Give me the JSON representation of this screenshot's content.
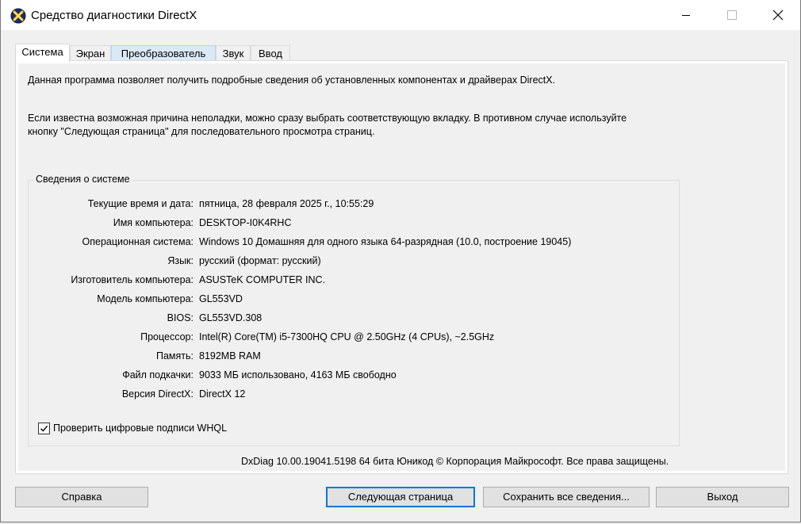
{
  "window": {
    "title": "Средство диагностики DirectX"
  },
  "tabs": [
    {
      "label": "Система",
      "active": true
    },
    {
      "label": "Экран",
      "active": false
    },
    {
      "label": "Преобразователь",
      "active": false
    },
    {
      "label": "Звук",
      "active": false
    },
    {
      "label": "Ввод",
      "active": false
    }
  ],
  "intro": {
    "line1": "Данная программа позволяет получить подробные сведения об установленных компонентах и драйверах DirectX.",
    "line2": "Если известна возможная причина неполадки, можно сразу выбрать соответствующую вкладку. В противном случае используйте",
    "line3": "кнопку \"Следующая страница\" для последовательного просмотра страниц."
  },
  "system_info": {
    "group_title": "Сведения о системе",
    "rows": [
      {
        "label": "Текущие время и дата:",
        "value": "пятница, 28 февраля 2025 г., 10:55:29"
      },
      {
        "label": "Имя компьютера:",
        "value": "DESKTOP-I0K4RHC"
      },
      {
        "label": "Операционная система:",
        "value": "Windows 10 Домашняя для одного языка 64-разрядная (10.0, построение 19045)"
      },
      {
        "label": "Язык:",
        "value": "русский (формат: русский)"
      },
      {
        "label": "Изготовитель компьютера:",
        "value": "ASUSTeK COMPUTER INC."
      },
      {
        "label": "Модель компьютера:",
        "value": "GL553VD"
      },
      {
        "label": "BIOS:",
        "value": "GL553VD.308"
      },
      {
        "label": "Процессор:",
        "value": "Intel(R) Core(TM) i5-7300HQ CPU @ 2.50GHz (4 CPUs), ~2.5GHz"
      },
      {
        "label": "Память:",
        "value": "8192MB RAM"
      },
      {
        "label": "Файл подкачки:",
        "value": "9033 МБ использовано, 4163 МБ свободно"
      },
      {
        "label": "Версия DirectX:",
        "value": "DirectX 12"
      }
    ],
    "whql_checkbox": {
      "label": "Проверить цифровые подписи WHQL",
      "checked": true
    }
  },
  "copyright": "DxDiag 10.00.19041.5198 64 бита Юникод © Корпорация Майкрософт. Все права защищены.",
  "buttons": {
    "help": "Справка",
    "next": "Следующая страница",
    "save": "Сохранить все сведения...",
    "exit": "Выход"
  },
  "icons": {
    "app": "directx-icon",
    "minimize": "minimize-icon",
    "maximize": "maximize-icon",
    "close": "close-icon",
    "check": "checkmark-icon"
  },
  "colors": {
    "default_button_border": "#0078d7",
    "tab_hover": "#dbe9f7"
  }
}
